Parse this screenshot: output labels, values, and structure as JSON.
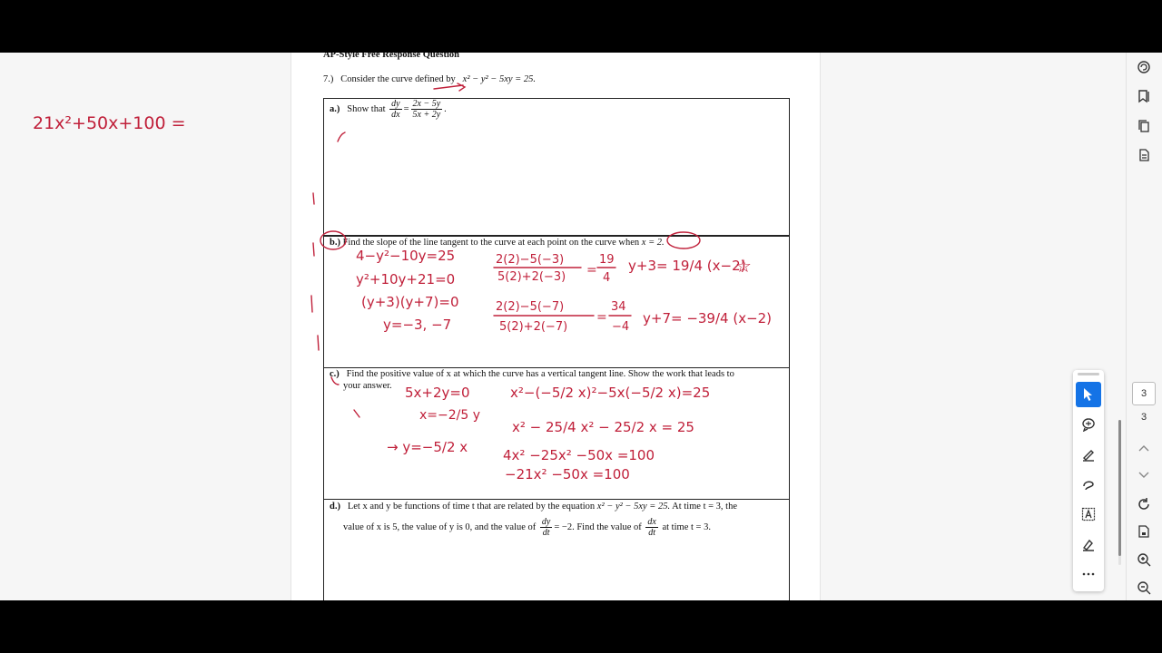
{
  "document": {
    "heading": "AP-Style Free Response Question",
    "question_number": "7.)",
    "question_intro": "Consider the curve defined by",
    "curve_equation": "x² − y² − 5xy = 25.",
    "part_a": {
      "label": "a.)",
      "text": "Show that",
      "frac_num_left": "dy",
      "frac_den_left": "dx",
      "equals": "=",
      "frac_num_right": "2x − 5y",
      "frac_den_right": "5x + 2y",
      "end": "."
    },
    "part_b": {
      "label": "b.)",
      "text": "Find the slope of the line tangent to the curve at each point on the curve when",
      "condition": "x = 2."
    },
    "part_c": {
      "label": "c.)",
      "text_line1": "Find the positive value of x at which the curve has a vertical tangent line.  Show the work that leads to",
      "text_line2": "your answer."
    },
    "part_d": {
      "label": "d.)",
      "text_line1a": "Let x and y be functions of time t that are related by the equation",
      "text_line1_eq": "x² − y² − 5xy = 25.",
      "text_line1b": "At time t = 3, the",
      "text_line2a": "value of x is 5, the value of y is 0, and the value of",
      "frac1_num": "dy",
      "frac1_den": "dt",
      "text_line2b": "= −2.  Find the value of",
      "frac2_num": "dx",
      "frac2_den": "dt",
      "text_line2c": "at time t = 3."
    }
  },
  "handwriting": {
    "margin_note": "21x²+50x+100 =",
    "b_work": [
      "4−y²−10y=25",
      "y²+10y+21=0",
      "(y+3)(y+7)=0",
      "y=−3, −7"
    ],
    "b_slope1_num": "2(2)−5(−3)",
    "b_slope1_den": "5(2)+2(−3)",
    "b_slope1_val_num": "19",
    "b_slope1_val_den": "4",
    "b_line1": "y+3= 19/4 (x−2)",
    "b_slope2_num": "2(2)−5(−7)",
    "b_slope2_den": "5(2)+2(−7)",
    "b_slope2_val_num": "34",
    "b_slope2_val_den": "−4",
    "b_line2": "y+7= −39/4 (x−2)",
    "c_work_left": [
      "5x+2y=0",
      "x=−2/5 y",
      "→ y=−5/2 x"
    ],
    "c_work_right": [
      "x²−(−5/2 x)²−5x(−5/2 x)=25",
      "x² − 25/4 x² − 25/2 x = 25",
      "4x² −25x² −50x =100",
      "−21x² −50x =100"
    ]
  },
  "viewer": {
    "current_page": "3",
    "total_pages": "3"
  },
  "colors": {
    "ink": "#c0203a",
    "accent": "#1473e6"
  },
  "icons": {
    "float_toolbar": [
      "select-cursor-icon",
      "add-comment-icon",
      "highlight-pen-icon",
      "draw-freehand-icon",
      "text-box-icon",
      "sign-icon",
      "more-icon"
    ],
    "rail": [
      "ai-assistant-icon",
      "bookmark-icon",
      "copy-pages-icon",
      "page-info-icon",
      "refresh-icon",
      "save-page-icon",
      "zoom-in-icon",
      "zoom-out-icon",
      "scroll-up-icon",
      "scroll-down-icon"
    ]
  }
}
